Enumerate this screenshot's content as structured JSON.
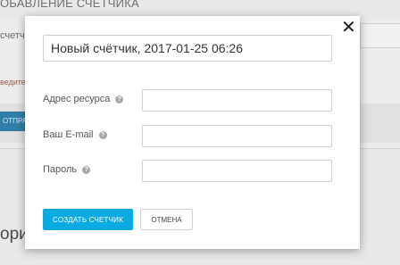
{
  "background": {
    "header_title": "обавление счетчика",
    "field_label_partial": "счетч",
    "hint_partial": "ведите",
    "send_button_partial": "отпра",
    "section_title_partial": "ори"
  },
  "modal": {
    "close_symbol": "✕",
    "name_value": "Новый счётчик, 2017-01-25 06:26",
    "fields": {
      "resource": {
        "label": "Адрес ресурса",
        "value": ""
      },
      "email": {
        "label": "Ваш E-mail",
        "value": ""
      },
      "password": {
        "label": "Пароль",
        "value": ""
      }
    },
    "help_symbol": "?",
    "create_label": "Создать счетчик",
    "cancel_label": "Отмена"
  },
  "colors": {
    "primary_button": "#0aabe3",
    "overlay_background": "#e9e9e9"
  }
}
